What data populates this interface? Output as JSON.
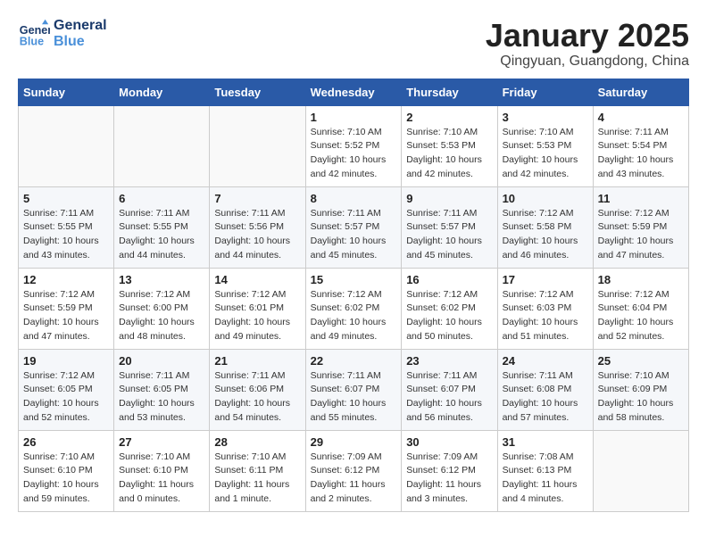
{
  "header": {
    "logo_line1": "General",
    "logo_line2": "Blue",
    "month_title": "January 2025",
    "location": "Qingyuan, Guangdong, China"
  },
  "weekdays": [
    "Sunday",
    "Monday",
    "Tuesday",
    "Wednesday",
    "Thursday",
    "Friday",
    "Saturday"
  ],
  "weeks": [
    [
      {
        "day": "",
        "info": ""
      },
      {
        "day": "",
        "info": ""
      },
      {
        "day": "",
        "info": ""
      },
      {
        "day": "1",
        "info": "Sunrise: 7:10 AM\nSunset: 5:52 PM\nDaylight: 10 hours\nand 42 minutes."
      },
      {
        "day": "2",
        "info": "Sunrise: 7:10 AM\nSunset: 5:53 PM\nDaylight: 10 hours\nand 42 minutes."
      },
      {
        "day": "3",
        "info": "Sunrise: 7:10 AM\nSunset: 5:53 PM\nDaylight: 10 hours\nand 42 minutes."
      },
      {
        "day": "4",
        "info": "Sunrise: 7:11 AM\nSunset: 5:54 PM\nDaylight: 10 hours\nand 43 minutes."
      }
    ],
    [
      {
        "day": "5",
        "info": "Sunrise: 7:11 AM\nSunset: 5:55 PM\nDaylight: 10 hours\nand 43 minutes."
      },
      {
        "day": "6",
        "info": "Sunrise: 7:11 AM\nSunset: 5:55 PM\nDaylight: 10 hours\nand 44 minutes."
      },
      {
        "day": "7",
        "info": "Sunrise: 7:11 AM\nSunset: 5:56 PM\nDaylight: 10 hours\nand 44 minutes."
      },
      {
        "day": "8",
        "info": "Sunrise: 7:11 AM\nSunset: 5:57 PM\nDaylight: 10 hours\nand 45 minutes."
      },
      {
        "day": "9",
        "info": "Sunrise: 7:11 AM\nSunset: 5:57 PM\nDaylight: 10 hours\nand 45 minutes."
      },
      {
        "day": "10",
        "info": "Sunrise: 7:12 AM\nSunset: 5:58 PM\nDaylight: 10 hours\nand 46 minutes."
      },
      {
        "day": "11",
        "info": "Sunrise: 7:12 AM\nSunset: 5:59 PM\nDaylight: 10 hours\nand 47 minutes."
      }
    ],
    [
      {
        "day": "12",
        "info": "Sunrise: 7:12 AM\nSunset: 5:59 PM\nDaylight: 10 hours\nand 47 minutes."
      },
      {
        "day": "13",
        "info": "Sunrise: 7:12 AM\nSunset: 6:00 PM\nDaylight: 10 hours\nand 48 minutes."
      },
      {
        "day": "14",
        "info": "Sunrise: 7:12 AM\nSunset: 6:01 PM\nDaylight: 10 hours\nand 49 minutes."
      },
      {
        "day": "15",
        "info": "Sunrise: 7:12 AM\nSunset: 6:02 PM\nDaylight: 10 hours\nand 49 minutes."
      },
      {
        "day": "16",
        "info": "Sunrise: 7:12 AM\nSunset: 6:02 PM\nDaylight: 10 hours\nand 50 minutes."
      },
      {
        "day": "17",
        "info": "Sunrise: 7:12 AM\nSunset: 6:03 PM\nDaylight: 10 hours\nand 51 minutes."
      },
      {
        "day": "18",
        "info": "Sunrise: 7:12 AM\nSunset: 6:04 PM\nDaylight: 10 hours\nand 52 minutes."
      }
    ],
    [
      {
        "day": "19",
        "info": "Sunrise: 7:12 AM\nSunset: 6:05 PM\nDaylight: 10 hours\nand 52 minutes."
      },
      {
        "day": "20",
        "info": "Sunrise: 7:11 AM\nSunset: 6:05 PM\nDaylight: 10 hours\nand 53 minutes."
      },
      {
        "day": "21",
        "info": "Sunrise: 7:11 AM\nSunset: 6:06 PM\nDaylight: 10 hours\nand 54 minutes."
      },
      {
        "day": "22",
        "info": "Sunrise: 7:11 AM\nSunset: 6:07 PM\nDaylight: 10 hours\nand 55 minutes."
      },
      {
        "day": "23",
        "info": "Sunrise: 7:11 AM\nSunset: 6:07 PM\nDaylight: 10 hours\nand 56 minutes."
      },
      {
        "day": "24",
        "info": "Sunrise: 7:11 AM\nSunset: 6:08 PM\nDaylight: 10 hours\nand 57 minutes."
      },
      {
        "day": "25",
        "info": "Sunrise: 7:10 AM\nSunset: 6:09 PM\nDaylight: 10 hours\nand 58 minutes."
      }
    ],
    [
      {
        "day": "26",
        "info": "Sunrise: 7:10 AM\nSunset: 6:10 PM\nDaylight: 10 hours\nand 59 minutes."
      },
      {
        "day": "27",
        "info": "Sunrise: 7:10 AM\nSunset: 6:10 PM\nDaylight: 11 hours\nand 0 minutes."
      },
      {
        "day": "28",
        "info": "Sunrise: 7:10 AM\nSunset: 6:11 PM\nDaylight: 11 hours\nand 1 minute."
      },
      {
        "day": "29",
        "info": "Sunrise: 7:09 AM\nSunset: 6:12 PM\nDaylight: 11 hours\nand 2 minutes."
      },
      {
        "day": "30",
        "info": "Sunrise: 7:09 AM\nSunset: 6:12 PM\nDaylight: 11 hours\nand 3 minutes."
      },
      {
        "day": "31",
        "info": "Sunrise: 7:08 AM\nSunset: 6:13 PM\nDaylight: 11 hours\nand 4 minutes."
      },
      {
        "day": "",
        "info": ""
      }
    ]
  ]
}
